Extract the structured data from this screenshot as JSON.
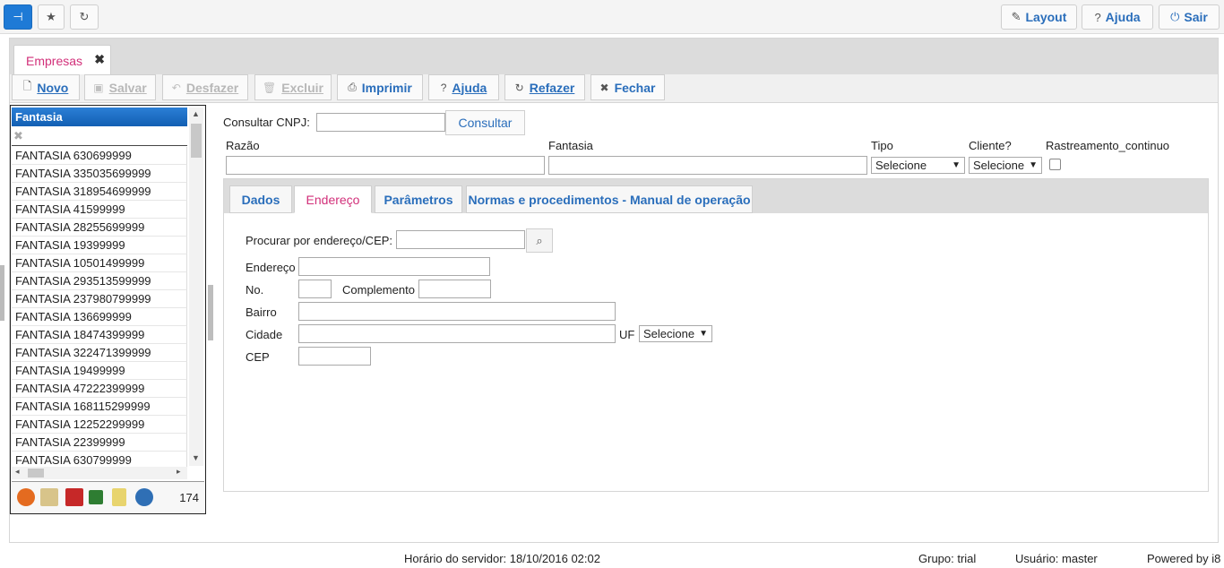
{
  "topbar": {
    "layout_label": "Layout",
    "help_label": "Ajuda",
    "exit_label": "Sair"
  },
  "tab": {
    "label": "Empresas"
  },
  "actions": {
    "novo": "Novo",
    "salvar": "Salvar",
    "desfazer": "Desfazer",
    "excluir": "Excluir",
    "imprimir": "Imprimir",
    "ajuda": "Ajuda",
    "refazer": "Refazer",
    "fechar": "Fechar"
  },
  "list": {
    "header": "Fantasia",
    "items": [
      "FANTASIA 630699999",
      "FANTASIA 335035699999",
      "FANTASIA 318954699999",
      "FANTASIA 41599999",
      "FANTASIA 28255699999",
      "FANTASIA 19399999",
      "FANTASIA 10501499999",
      "FANTASIA 293513599999",
      "FANTASIA 237980799999",
      "FANTASIA 136699999",
      "FANTASIA 18474399999",
      "FANTASIA 322471399999",
      "FANTASIA 19499999",
      "FANTASIA 47222399999",
      "FANTASIA 168115299999",
      "FANTASIA 12252299999",
      "FANTASIA 22399999",
      "FANTASIA 630799999"
    ],
    "count": "174"
  },
  "form": {
    "consultar_cnpj_label": "Consultar CNPJ:",
    "consultar_button": "Consultar",
    "razao_label": "Razão",
    "fantasia_label": "Fantasia",
    "tipo_label": "Tipo",
    "tipo_value": "Selecione",
    "cliente_label": "Cliente?",
    "cliente_value": "Selecione",
    "rastreamento_label": "Rastreamento_continuo"
  },
  "inner_tabs": [
    "Dados",
    "Endereço",
    "Parâmetros",
    "Normas e procedimentos - Manual de operação"
  ],
  "endereco": {
    "procurar_label": "Procurar por endereço/CEP:",
    "endereco_label": "Endereço",
    "no_label": "No.",
    "complemento_label": "Complemento",
    "bairro_label": "Bairro",
    "cidade_label": "Cidade",
    "uf_label": "UF",
    "uf_value": "Selecione",
    "cep_label": "CEP"
  },
  "status": {
    "server_time": "Horário do servidor: 18/10/2016 02:02",
    "grupo": "Grupo: trial",
    "usuario": "Usuário: master",
    "powered": "Powered by i8"
  },
  "colors": {
    "accent": "#1e7ad6",
    "tab_active": "#d2307a",
    "link": "#2a6ebb"
  }
}
